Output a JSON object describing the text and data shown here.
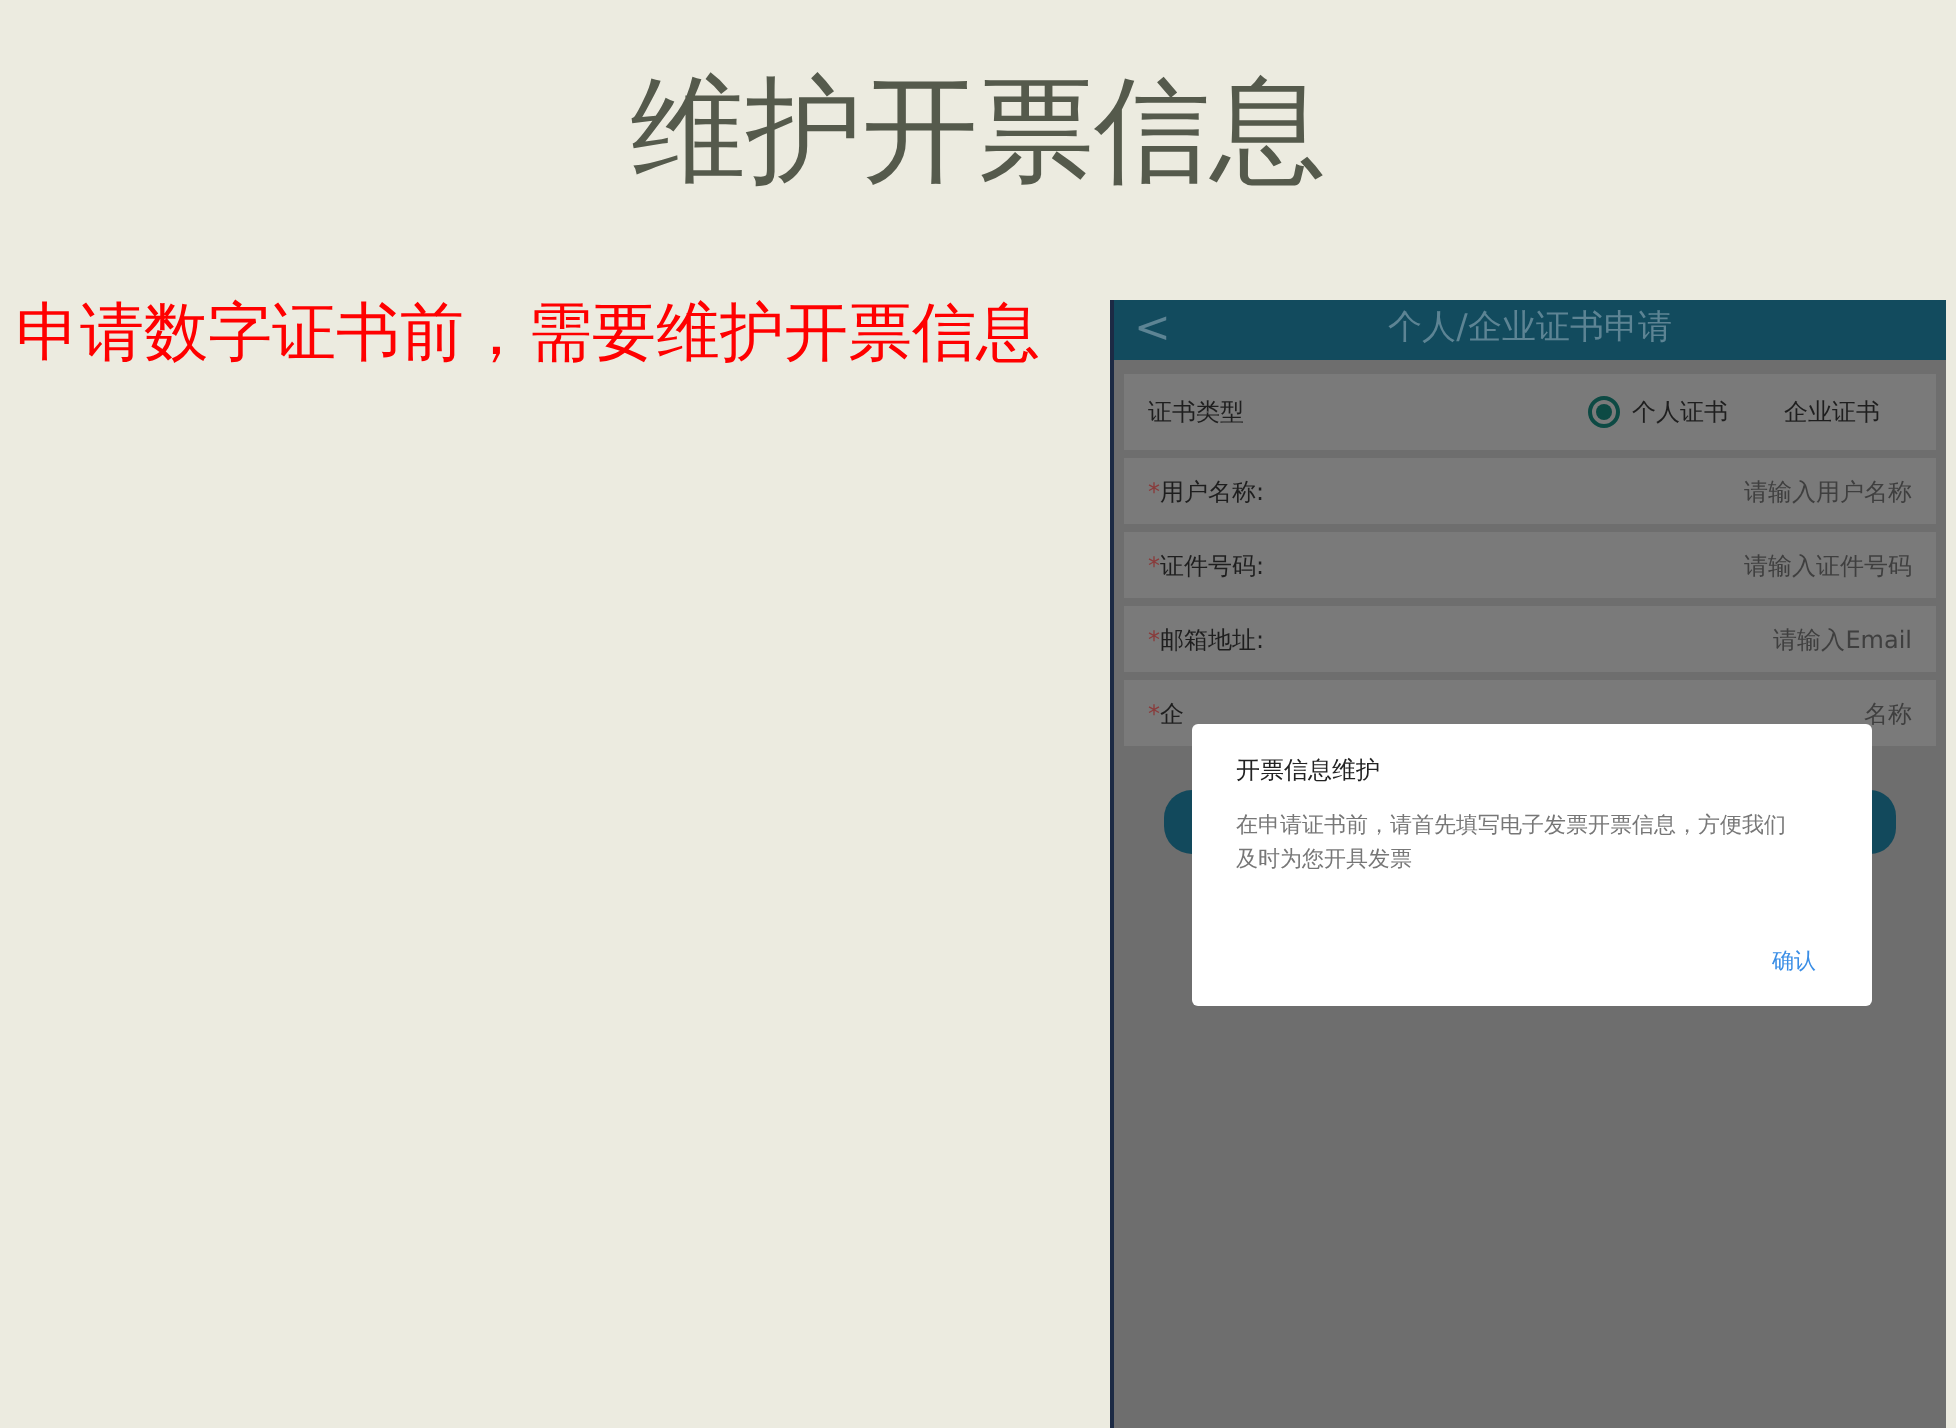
{
  "slide": {
    "title": "维护开票信息",
    "note": "申请数字证书前，需要维护开票信息"
  },
  "phone": {
    "header": {
      "back": "<",
      "title": "个人/企业证书申请"
    },
    "cert_type": {
      "label": "证书类型",
      "options": [
        {
          "label": "个人证书",
          "selected": true
        },
        {
          "label": "企业证书",
          "selected": false
        }
      ]
    },
    "fields": [
      {
        "mark": "*",
        "label": "用户名称:",
        "placeholder": "请输入用户名称"
      },
      {
        "mark": "*",
        "label": "证件号码:",
        "placeholder": "请输入证件号码"
      },
      {
        "mark": "*",
        "label": "邮箱地址:",
        "placeholder": "请输入Email"
      },
      {
        "mark": "*",
        "label": "企",
        "placeholder": "名称"
      }
    ],
    "dialog": {
      "title": "开票信息维护",
      "message": "在申请证书前，请首先填写电子发票开票信息，方便我们及时为您开具发票",
      "confirm": "确认"
    }
  }
}
